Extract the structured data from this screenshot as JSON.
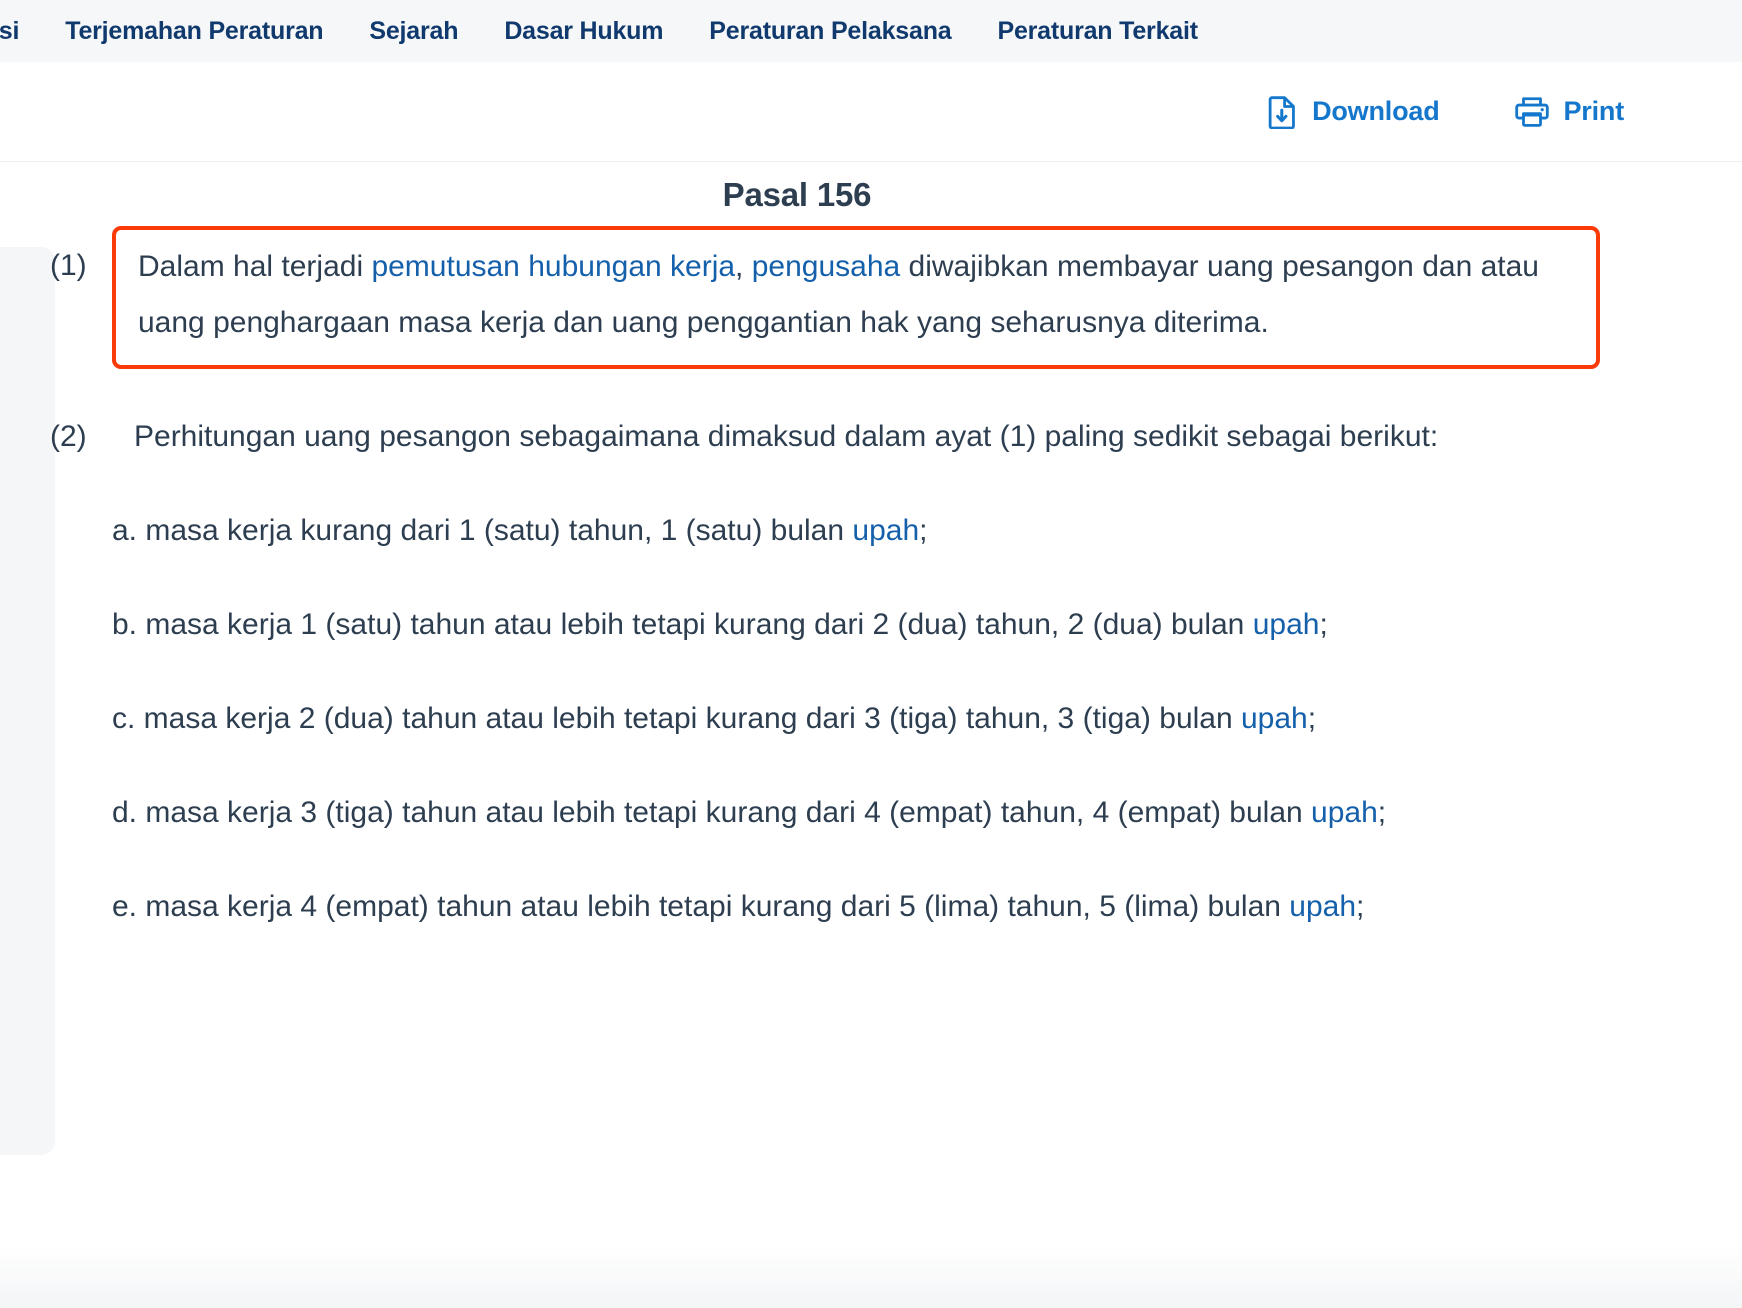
{
  "nav": {
    "items": [
      {
        "label": "dasi"
      },
      {
        "label": "Terjemahan Peraturan"
      },
      {
        "label": "Sejarah"
      },
      {
        "label": "Dasar Hukum"
      },
      {
        "label": "Peraturan Pelaksana"
      },
      {
        "label": "Peraturan Terkait"
      }
    ]
  },
  "actions": {
    "download_label": "Download",
    "download_icon": "file-download-icon",
    "print_label": "Print",
    "print_icon": "printer-icon"
  },
  "document": {
    "title": "Pasal 156",
    "clauses": [
      {
        "number": "(1)",
        "highlighted": true,
        "parts": [
          {
            "text": "Dalam hal terjadi ",
            "link": false
          },
          {
            "text": "pemutusan hubungan kerja",
            "link": true
          },
          {
            "text": ", ",
            "link": false
          },
          {
            "text": "pengusaha",
            "link": true
          },
          {
            "text": " diwajibkan membayar uang pesangon dan atau uang penghargaan masa kerja dan uang penggantian hak yang seharusnya diterima.",
            "link": false
          }
        ]
      },
      {
        "number": "(2)",
        "highlighted": false,
        "parts": [
          {
            "text": "Perhitungan uang pesangon sebagaimana dimaksud dalam ayat (1) paling sedikit sebagai berikut:",
            "link": false
          }
        ]
      }
    ],
    "sub_items": [
      {
        "parts": [
          {
            "text": "a. masa kerja kurang dari 1 (satu) tahun, 1 (satu) bulan ",
            "link": false
          },
          {
            "text": "upah",
            "link": true
          },
          {
            "text": ";",
            "link": false
          }
        ]
      },
      {
        "parts": [
          {
            "text": "b. masa kerja 1 (satu) tahun atau lebih tetapi kurang dari 2 (dua) tahun, 2 (dua) bulan ",
            "link": false
          },
          {
            "text": "upah",
            "link": true
          },
          {
            "text": ";",
            "link": false
          }
        ]
      },
      {
        "parts": [
          {
            "text": "c. masa kerja 2 (dua) tahun atau lebih tetapi kurang dari 3 (tiga) tahun, 3 (tiga) bulan ",
            "link": false
          },
          {
            "text": "upah",
            "link": true
          },
          {
            "text": ";",
            "link": false
          }
        ]
      },
      {
        "parts": [
          {
            "text": "d. masa kerja 3 (tiga) tahun atau lebih tetapi kurang dari 4 (empat) tahun, 4 (empat) bulan ",
            "link": false
          },
          {
            "text": "upah",
            "link": true
          },
          {
            "text": ";",
            "link": false
          }
        ]
      },
      {
        "parts": [
          {
            "text": "e. masa kerja 4 (empat) tahun atau lebih tetapi kurang dari 5 (lima) tahun, 5 (lima) bulan ",
            "link": false
          },
          {
            "text": "upah",
            "link": true
          },
          {
            "text": ";",
            "link": false
          }
        ]
      }
    ]
  },
  "colors": {
    "nav_text": "#10396d",
    "nav_bg": "#f5f7f9",
    "action_blue": "#1577cc",
    "body_text": "#2d3e50",
    "link_blue": "#1560ab",
    "highlight_border": "#fa3a09",
    "rail_bg": "#f4f6f8"
  }
}
